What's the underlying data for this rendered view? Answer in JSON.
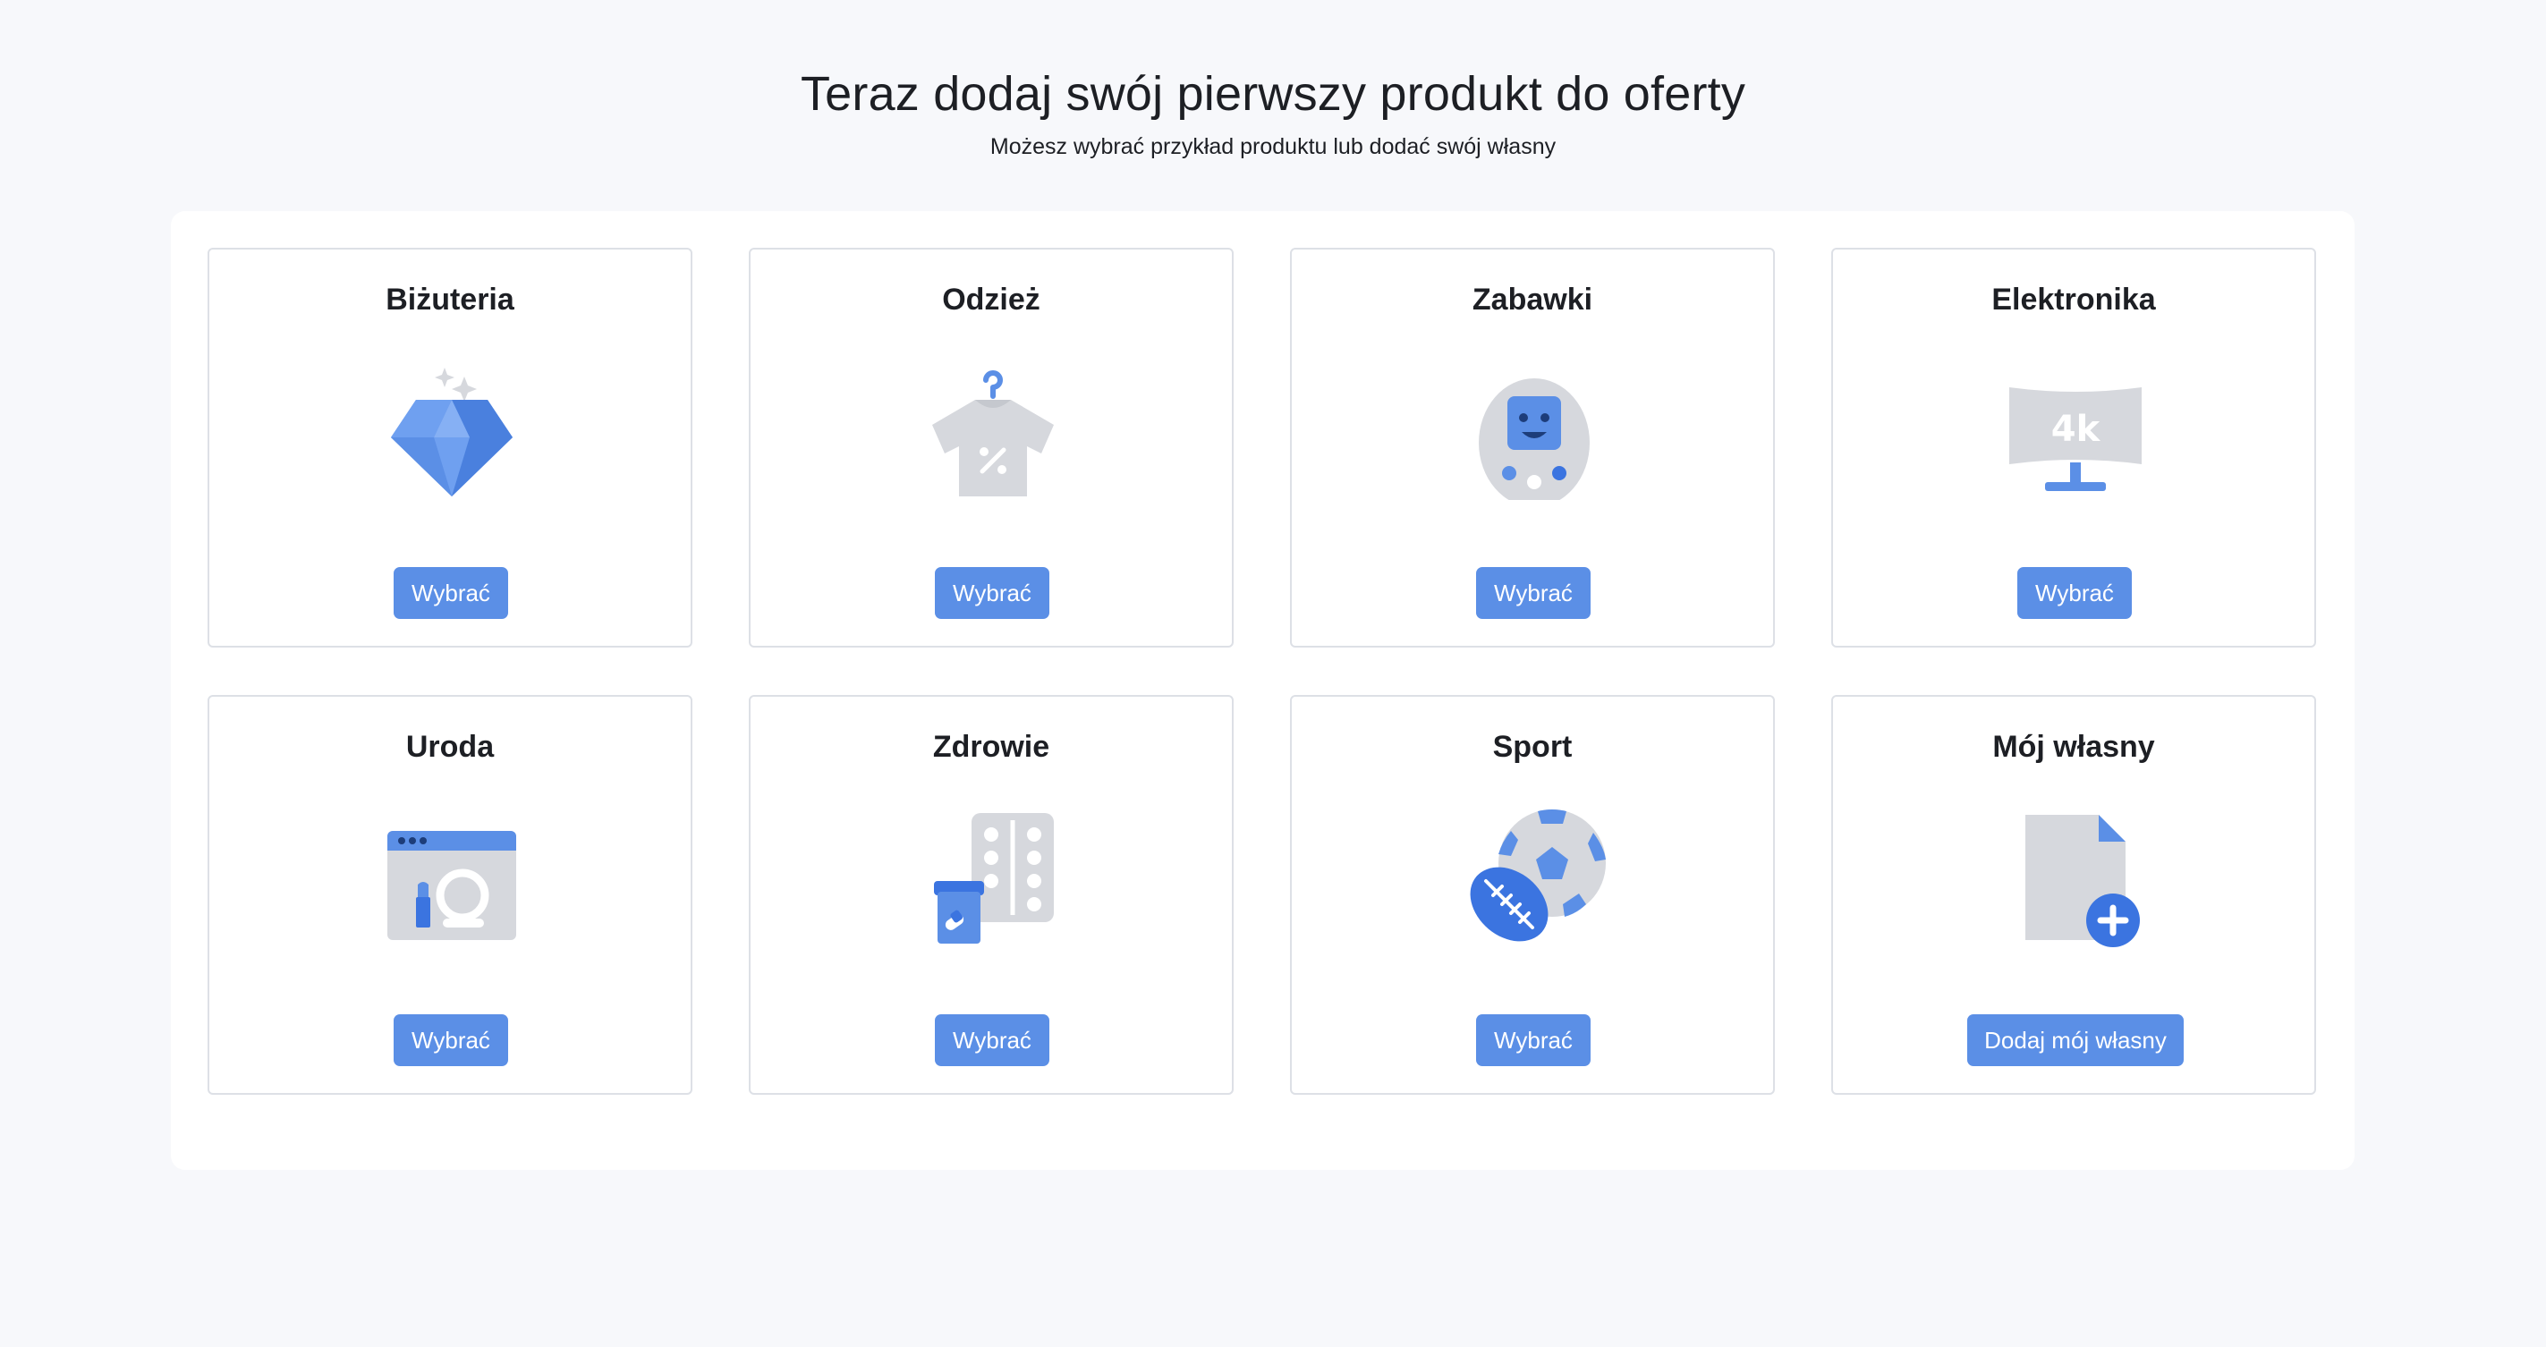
{
  "header": {
    "title": "Teraz dodaj swój pierwszy produkt do oferty",
    "subtitle": "Możesz wybrać przykład produktu lub dodać swój własny"
  },
  "colors": {
    "background": "#f7f8fb",
    "button": "#5b8fe6",
    "icon_blue": "#5b8fe6",
    "icon_dark_blue": "#3b74e0",
    "icon_gray": "#d6d8dd"
  },
  "categories": [
    {
      "title": "Biżuteria",
      "icon": "diamond-icon",
      "button": "Wybrać"
    },
    {
      "title": "Odzież",
      "icon": "tshirt-icon",
      "button": "Wybrać"
    },
    {
      "title": "Zabawki",
      "icon": "toy-icon",
      "button": "Wybrać"
    },
    {
      "title": "Elektronika",
      "icon": "monitor-icon",
      "button": "Wybrać"
    },
    {
      "title": "Uroda",
      "icon": "cosmetics-icon",
      "button": "Wybrać"
    },
    {
      "title": "Zdrowie",
      "icon": "pills-icon",
      "button": "Wybrać"
    },
    {
      "title": "Sport",
      "icon": "balls-icon",
      "button": "Wybrać"
    },
    {
      "title": "Mój własny",
      "icon": "add-file-icon",
      "button": "Dodaj mój własny"
    }
  ],
  "icon_texts": {
    "monitor_label": "4k"
  }
}
